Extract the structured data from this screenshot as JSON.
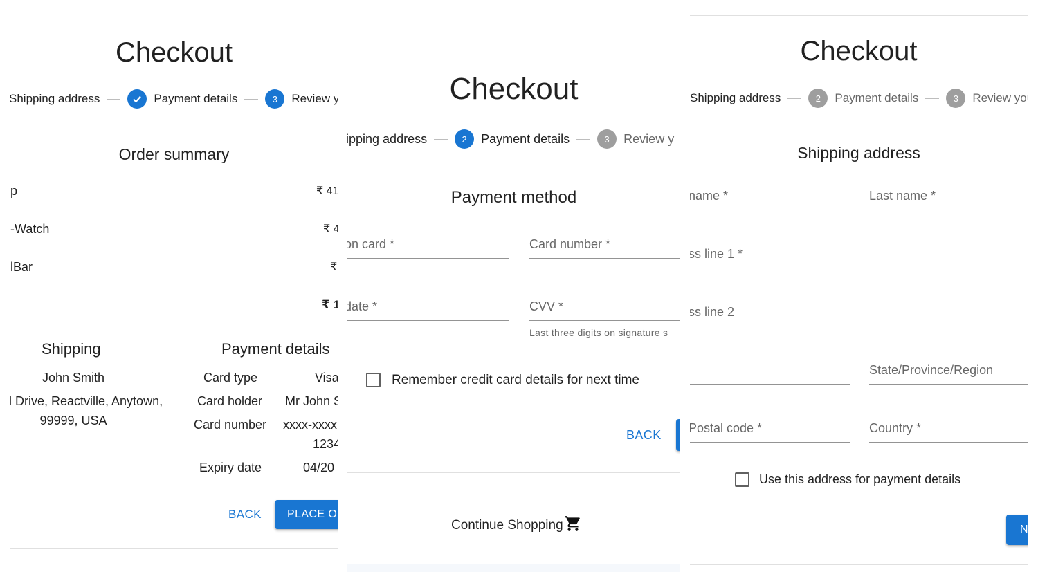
{
  "left": {
    "title": "Checkout",
    "steps": [
      {
        "label": "Shipping address"
      },
      {
        "label": "Payment details"
      },
      {
        "number": "3",
        "label": "Review your order"
      }
    ],
    "order_summary_title": "Order summary",
    "products": [
      {
        "name": "p",
        "price": "₹ 41"
      },
      {
        "name": "-Watch",
        "price": "₹ 4"
      },
      {
        "name": "lBar",
        "price": "₹"
      }
    ],
    "total": "₹ 1",
    "shipping": {
      "title": "Shipping",
      "name": "John Smith",
      "address_line1": "l Drive, Reactville, Anytown,",
      "address_line2": "99999, USA"
    },
    "payment": {
      "title": "Payment details",
      "rows": [
        {
          "label": "Card type",
          "value": "Visa"
        },
        {
          "label": "Card holder",
          "value": "Mr John S"
        },
        {
          "label": "Card number",
          "value": "xxxx-xxxx",
          "value2": "1234"
        },
        {
          "label": "Expiry date",
          "value": "04/20"
        }
      ]
    },
    "back_label": "BACK",
    "place_order_label": "PLACE OR"
  },
  "middle": {
    "title": "Checkout",
    "steps": [
      {
        "label": "ipping address"
      },
      {
        "number": "2",
        "label": "Payment details"
      },
      {
        "number": "3",
        "label": "Review y"
      }
    ],
    "section_title": "Payment method",
    "fields": {
      "name_on_card": "on card *",
      "card_number": "Card number *",
      "expiry_date": "date *",
      "cvv": "CVV *"
    },
    "cvv_helper": "Last three digits on signature s",
    "remember_label": "Remember credit card details for next time",
    "back_label": "BACK",
    "continue_shopping": "Continue Shopping"
  },
  "right": {
    "title": "Checkout",
    "steps": [
      {
        "label": "Shipping address"
      },
      {
        "number": "2",
        "label": "Payment details"
      },
      {
        "number": "3",
        "label": "Review your"
      }
    ],
    "section_title": "Shipping address",
    "fields": {
      "first_name": "name *",
      "last_name": "Last name *",
      "address1": "ss line 1 *",
      "address2": "ss line 2",
      "city": "",
      "state": "State/Province/Region",
      "postal_code": "Postal code *",
      "country": "Country *"
    },
    "use_address_label": "Use this address for payment details",
    "next_label": "N"
  },
  "colors": {
    "primary": "#1976d2",
    "step_inactive": "#9e9e9e",
    "divider": "#e0e0e0"
  }
}
